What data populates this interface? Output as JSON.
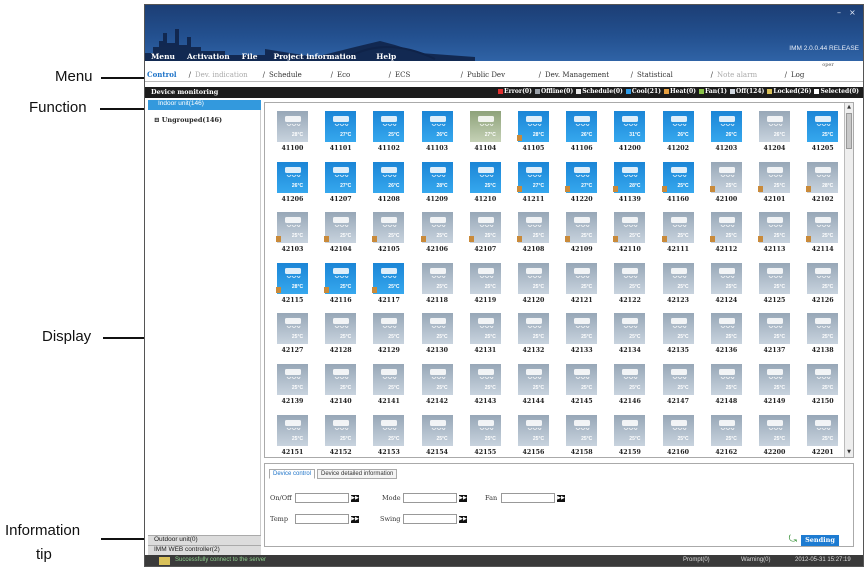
{
  "callouts": {
    "menu": "Menu",
    "function": "Function",
    "display": "Display",
    "info_line1": "Information",
    "info_line2": "tip"
  },
  "window": {
    "release": "IMM 2.0.0.44 RELEASE",
    "user_tab": "oper",
    "minimize": "–",
    "close": "×"
  },
  "menu": [
    "Menu",
    "Activation",
    "File",
    "Project information",
    "Help"
  ],
  "functions": [
    {
      "label": "Control",
      "state": "active"
    },
    {
      "label": "Dev. indication",
      "state": "dim"
    },
    {
      "label": "Schedule",
      "state": "normal"
    },
    {
      "label": "Eco",
      "state": "normal"
    },
    {
      "label": "ECS",
      "state": "normal"
    },
    {
      "label": "Public Dev",
      "state": "normal"
    },
    {
      "label": "Dev. Management",
      "state": "normal"
    },
    {
      "label": "Statistical",
      "state": "normal"
    },
    {
      "label": "Note alarm",
      "state": "dim"
    },
    {
      "label": "Log",
      "state": "normal"
    }
  ],
  "monitor": {
    "title": "Device monitoring",
    "legend": [
      {
        "text": "Error(0)",
        "color": "#e03030"
      },
      {
        "text": "Offline(0)",
        "color": "#9aa0a8"
      },
      {
        "text": "Schedule(0)",
        "color": "#e8e8e8"
      },
      {
        "text": "Cool(21)",
        "color": "#2d9be8"
      },
      {
        "text": "Heat(0)",
        "color": "#e8a040"
      },
      {
        "text": "Fan(1)",
        "color": "#8bc34a"
      },
      {
        "text": "Off(124)",
        "color": "#cfd6de"
      },
      {
        "text": "Locked(26)",
        "color": "#d9c15a"
      },
      {
        "text": "Selected(0)",
        "color": "#ffffff"
      }
    ]
  },
  "tree": {
    "selected": "Indoor unit(146)",
    "group": "Ungrouped(146)",
    "bottom_tabs": [
      "Outdoor unit(0)",
      "IMM WEB controller(2)"
    ]
  },
  "units": [
    {
      "id": "41100",
      "temp": "28°C",
      "state": "off"
    },
    {
      "id": "41101",
      "temp": "27°C",
      "state": "cool"
    },
    {
      "id": "41102",
      "temp": "25°C",
      "state": "cool"
    },
    {
      "id": "41103",
      "temp": "26°C",
      "state": "cool"
    },
    {
      "id": "41104",
      "temp": "27°C",
      "state": "sel"
    },
    {
      "id": "41105",
      "temp": "28°C",
      "state": "cool",
      "flag": true
    },
    {
      "id": "41106",
      "temp": "26°C",
      "state": "cool"
    },
    {
      "id": "41200",
      "temp": "31°C",
      "state": "cool"
    },
    {
      "id": "41202",
      "temp": "26°C",
      "state": "cool"
    },
    {
      "id": "41203",
      "temp": "26°C",
      "state": "cool"
    },
    {
      "id": "41204",
      "temp": "26°C",
      "state": "off"
    },
    {
      "id": "41205",
      "temp": "25°C",
      "state": "cool"
    },
    {
      "id": "41206",
      "temp": "26°C",
      "state": "cool"
    },
    {
      "id": "41207",
      "temp": "27°C",
      "state": "cool"
    },
    {
      "id": "41208",
      "temp": "26°C",
      "state": "cool"
    },
    {
      "id": "41209",
      "temp": "28°C",
      "state": "cool"
    },
    {
      "id": "41210",
      "temp": "25°C",
      "state": "cool"
    },
    {
      "id": "41211",
      "temp": "27°C",
      "state": "cool",
      "flag": true
    },
    {
      "id": "41220",
      "temp": "27°C",
      "state": "cool",
      "flag": true
    },
    {
      "id": "41139",
      "temp": "28°C",
      "state": "cool",
      "flag": true
    },
    {
      "id": "41160",
      "temp": "25°C",
      "state": "cool",
      "flag": true
    },
    {
      "id": "42100",
      "temp": "25°C",
      "state": "off",
      "flag": true
    },
    {
      "id": "42101",
      "temp": "25°C",
      "state": "off",
      "flag": true
    },
    {
      "id": "42102",
      "temp": "28°C",
      "state": "off",
      "flag": true
    },
    {
      "id": "42103",
      "temp": "25°C",
      "state": "off",
      "flag": true
    },
    {
      "id": "42104",
      "temp": "25°C",
      "state": "off",
      "flag": true
    },
    {
      "id": "42105",
      "temp": "25°C",
      "state": "off",
      "flag": true
    },
    {
      "id": "42106",
      "temp": "25°C",
      "state": "off",
      "flag": true
    },
    {
      "id": "42107",
      "temp": "25°C",
      "state": "off",
      "flag": true
    },
    {
      "id": "42108",
      "temp": "25°C",
      "state": "off",
      "flag": true
    },
    {
      "id": "42109",
      "temp": "25°C",
      "state": "off",
      "flag": true
    },
    {
      "id": "42110",
      "temp": "25°C",
      "state": "off",
      "flag": true
    },
    {
      "id": "42111",
      "temp": "25°C",
      "state": "off",
      "flag": true
    },
    {
      "id": "42112",
      "temp": "25°C",
      "state": "off",
      "flag": true
    },
    {
      "id": "42113",
      "temp": "25°C",
      "state": "off",
      "flag": true
    },
    {
      "id": "42114",
      "temp": "25°C",
      "state": "off",
      "flag": true
    },
    {
      "id": "42115",
      "temp": "28°C",
      "state": "cool",
      "flag": true
    },
    {
      "id": "42116",
      "temp": "25°C",
      "state": "cool",
      "flag": true
    },
    {
      "id": "42117",
      "temp": "25°C",
      "state": "cool",
      "flag": true
    },
    {
      "id": "42118",
      "temp": "25°C",
      "state": "off"
    },
    {
      "id": "42119",
      "temp": "25°C",
      "state": "off"
    },
    {
      "id": "42120",
      "temp": "25°C",
      "state": "off"
    },
    {
      "id": "42121",
      "temp": "25°C",
      "state": "off"
    },
    {
      "id": "42122",
      "temp": "25°C",
      "state": "off"
    },
    {
      "id": "42123",
      "temp": "25°C",
      "state": "off"
    },
    {
      "id": "42124",
      "temp": "25°C",
      "state": "off"
    },
    {
      "id": "42125",
      "temp": "25°C",
      "state": "off"
    },
    {
      "id": "42126",
      "temp": "25°C",
      "state": "off"
    },
    {
      "id": "42127",
      "temp": "25°C",
      "state": "off"
    },
    {
      "id": "42128",
      "temp": "25°C",
      "state": "off"
    },
    {
      "id": "42129",
      "temp": "25°C",
      "state": "off"
    },
    {
      "id": "42130",
      "temp": "25°C",
      "state": "off"
    },
    {
      "id": "42131",
      "temp": "25°C",
      "state": "off"
    },
    {
      "id": "42132",
      "temp": "25°C",
      "state": "off"
    },
    {
      "id": "42133",
      "temp": "25°C",
      "state": "off"
    },
    {
      "id": "42134",
      "temp": "25°C",
      "state": "off"
    },
    {
      "id": "42135",
      "temp": "25°C",
      "state": "off"
    },
    {
      "id": "42136",
      "temp": "25°C",
      "state": "off"
    },
    {
      "id": "42137",
      "temp": "25°C",
      "state": "off"
    },
    {
      "id": "42138",
      "temp": "25°C",
      "state": "off"
    },
    {
      "id": "42139",
      "temp": "25°C",
      "state": "off"
    },
    {
      "id": "42140",
      "temp": "25°C",
      "state": "off"
    },
    {
      "id": "42141",
      "temp": "25°C",
      "state": "off"
    },
    {
      "id": "42142",
      "temp": "25°C",
      "state": "off"
    },
    {
      "id": "42143",
      "temp": "25°C",
      "state": "off"
    },
    {
      "id": "42144",
      "temp": "25°C",
      "state": "off"
    },
    {
      "id": "42145",
      "temp": "25°C",
      "state": "off"
    },
    {
      "id": "42146",
      "temp": "25°C",
      "state": "off"
    },
    {
      "id": "42147",
      "temp": "25°C",
      "state": "off"
    },
    {
      "id": "42148",
      "temp": "25°C",
      "state": "off"
    },
    {
      "id": "42149",
      "temp": "25°C",
      "state": "off"
    },
    {
      "id": "42150",
      "temp": "25°C",
      "state": "off"
    },
    {
      "id": "42151",
      "temp": "25°C",
      "state": "off"
    },
    {
      "id": "42152",
      "temp": "25°C",
      "state": "off"
    },
    {
      "id": "42153",
      "temp": "25°C",
      "state": "off"
    },
    {
      "id": "42154",
      "temp": "25°C",
      "state": "off"
    },
    {
      "id": "42155",
      "temp": "25°C",
      "state": "off"
    },
    {
      "id": "42156",
      "temp": "25°C",
      "state": "off"
    },
    {
      "id": "42158",
      "temp": "25°C",
      "state": "off"
    },
    {
      "id": "42159",
      "temp": "25°C",
      "state": "off"
    },
    {
      "id": "42160",
      "temp": "25°C",
      "state": "off"
    },
    {
      "id": "42162",
      "temp": "25°C",
      "state": "off"
    },
    {
      "id": "42200",
      "temp": "25°C",
      "state": "off"
    },
    {
      "id": "42201",
      "temp": "25°C",
      "state": "off"
    }
  ],
  "control": {
    "tabs": [
      "Device control",
      "Device detailed information"
    ],
    "on_off": "On/Off",
    "mode": "Mode",
    "fan": "Fan",
    "temp": "Temp",
    "swing": "Swing",
    "go": "▶▶",
    "send": "Sending"
  },
  "statusbar": {
    "message": "Successfully connect to the server",
    "prompt": "Prompt(0)",
    "warning": "Warning(0)",
    "datetime": "2012-05-31 15:27:19"
  }
}
